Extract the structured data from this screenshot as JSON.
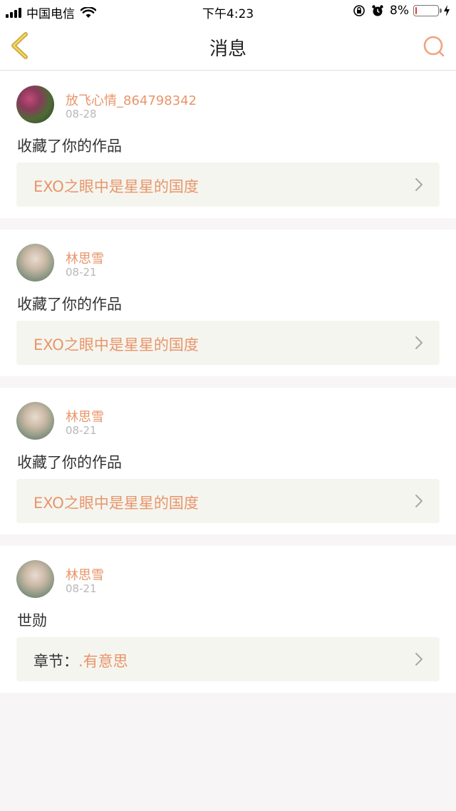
{
  "status_bar": {
    "carrier": "中国电信",
    "time": "下午4:23",
    "battery_percent": "8%",
    "battery_level": 0.08,
    "battery_color": "#e23b2e"
  },
  "nav": {
    "title": "消息",
    "accent": "#e8956a",
    "back_icon": "chevron-left-icon",
    "search_icon": "search-icon"
  },
  "messages": [
    {
      "username": "放飞心情_864798342",
      "date": "08-28",
      "action": "收藏了你的作品",
      "work_prefix": "",
      "work_title": "EXO之眼中是星星的国度"
    },
    {
      "username": "林思雪",
      "date": "08-21",
      "action": "收藏了你的作品",
      "work_prefix": "",
      "work_title": "EXO之眼中是星星的国度"
    },
    {
      "username": "林思雪",
      "date": "08-21",
      "action": "收藏了你的作品",
      "work_prefix": "",
      "work_title": "EXO之眼中是星星的国度"
    },
    {
      "username": "林思雪",
      "date": "08-21",
      "action": "世勋",
      "work_prefix": "章节：",
      "work_title": ".有意思"
    }
  ]
}
